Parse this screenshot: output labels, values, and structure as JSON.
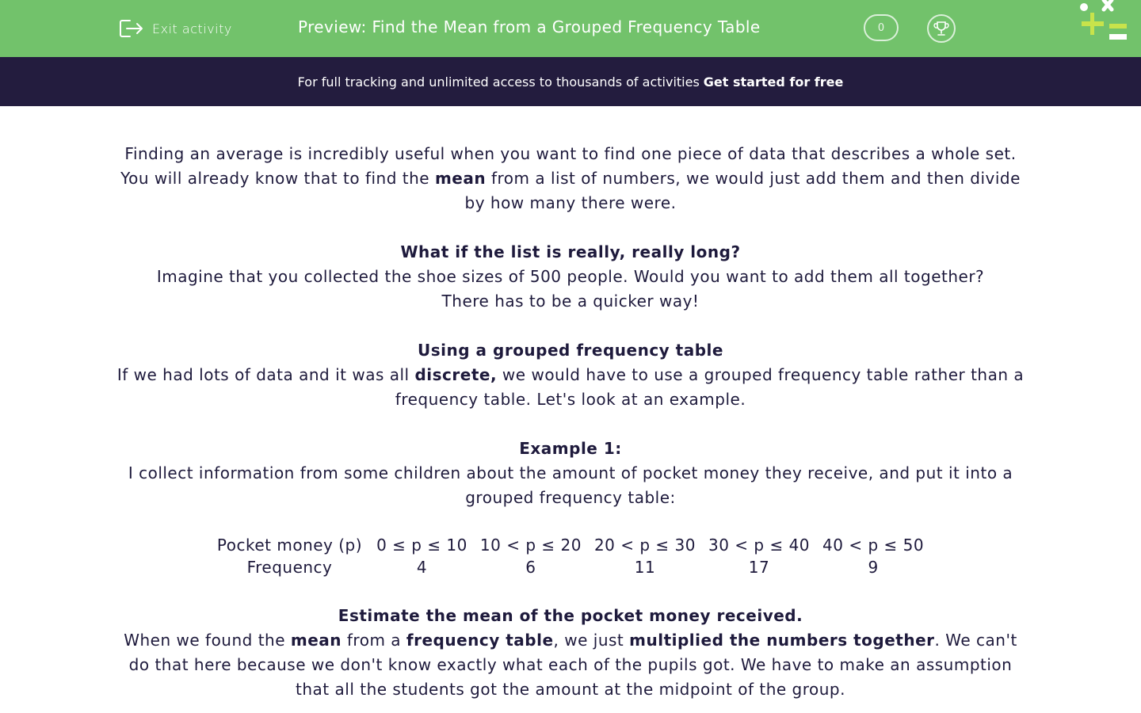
{
  "header": {
    "exit_label": "Exit activity",
    "title": "Preview: Find the Mean from a Grouped Frequency Table",
    "score": "0"
  },
  "promo": {
    "text": "For full tracking and unlimited access to thousands of activities",
    "cta": "Get started for free"
  },
  "content": {
    "p1": "Finding an average is incredibly useful when you want to find one piece of data that describes a whole set.",
    "p2_a": "You will already know that to find the ",
    "p2_b": "mean",
    "p2_c": " from a list of numbers, we would just add them and then divide by how many there were.",
    "h1": "What if the list is really, really long?",
    "p3": "Imagine that you collected the shoe sizes of 500 people. Would you want to add them all together?",
    "p4": "There has to be a quicker way!",
    "h2": "Using a grouped frequency table",
    "p5_a": "If we had lots of data and it was all ",
    "p5_b": "discrete,",
    "p5_c": " we would have to use a grouped frequency table rather than a frequency table. Let's look at an example.",
    "h3": "Example 1:",
    "p6": "I collect information from some children about the amount of pocket money they receive, and put it into a grouped frequency table:",
    "table": {
      "row1_label": "Pocket money (p)",
      "row2_label": "Frequency",
      "groups": [
        "0 ≤ p ≤ 10",
        "10 < p ≤ 20",
        "20 < p ≤ 30",
        "30 < p ≤ 40",
        "40 < p ≤ 50"
      ],
      "frequencies": [
        "4",
        "6",
        "11",
        "17",
        "9"
      ]
    },
    "h4": "Estimate the mean of the pocket money received.",
    "p7_a": "When we found the ",
    "p7_b": "mean",
    "p7_c": " from a ",
    "p7_d": "frequency table",
    "p7_e": ", we just ",
    "p7_f": "multiplied the numbers together",
    "p7_g": ". We can't do that here because we don't know exactly what  each of the pupils got. We have to make an assumption that all the students got the amount at the midpoint of the group."
  },
  "colors": {
    "header_bg": "#72c26b",
    "promo_bg": "#231c3e",
    "text": "#1e1a3c",
    "logo_accent": "#c8e34b"
  }
}
